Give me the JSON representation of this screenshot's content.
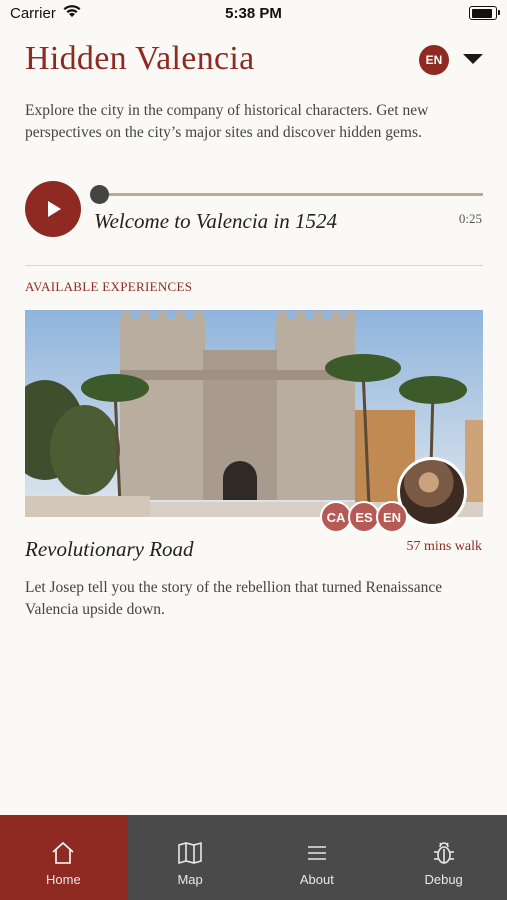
{
  "status_bar": {
    "carrier": "Carrier",
    "time": "5:38 PM",
    "battery_level": 1.0
  },
  "header": {
    "title": "Hidden Valencia",
    "language": "EN"
  },
  "intro": {
    "text": "Explore the city in the company of historical characters. Get new perspectives on the city’s major sites and discover hidden gems."
  },
  "audio": {
    "title": "Welcome to Valencia in 1524",
    "duration": "0:25",
    "progress": 0
  },
  "section": {
    "label": "AVAILABLE EXPERIENCES"
  },
  "experience": {
    "title": "Revolutionary Road",
    "walk_time": "57 mins walk",
    "description": "Let Josep tell you the story of the rebellion that turned Renaissance Valencia upside down.",
    "languages": [
      "CA",
      "ES",
      "EN"
    ]
  },
  "tabs": [
    {
      "label": "Home",
      "icon": "home-icon",
      "active": true
    },
    {
      "label": "Map",
      "icon": "map-icon",
      "active": false
    },
    {
      "label": "About",
      "icon": "menu-icon",
      "active": false
    },
    {
      "label": "Debug",
      "icon": "bug-icon",
      "active": false
    }
  ],
  "colors": {
    "accent": "#8e2a22",
    "chip": "#b55a54",
    "tabbar": "#4a4a4a",
    "background": "#fbf9f6"
  }
}
